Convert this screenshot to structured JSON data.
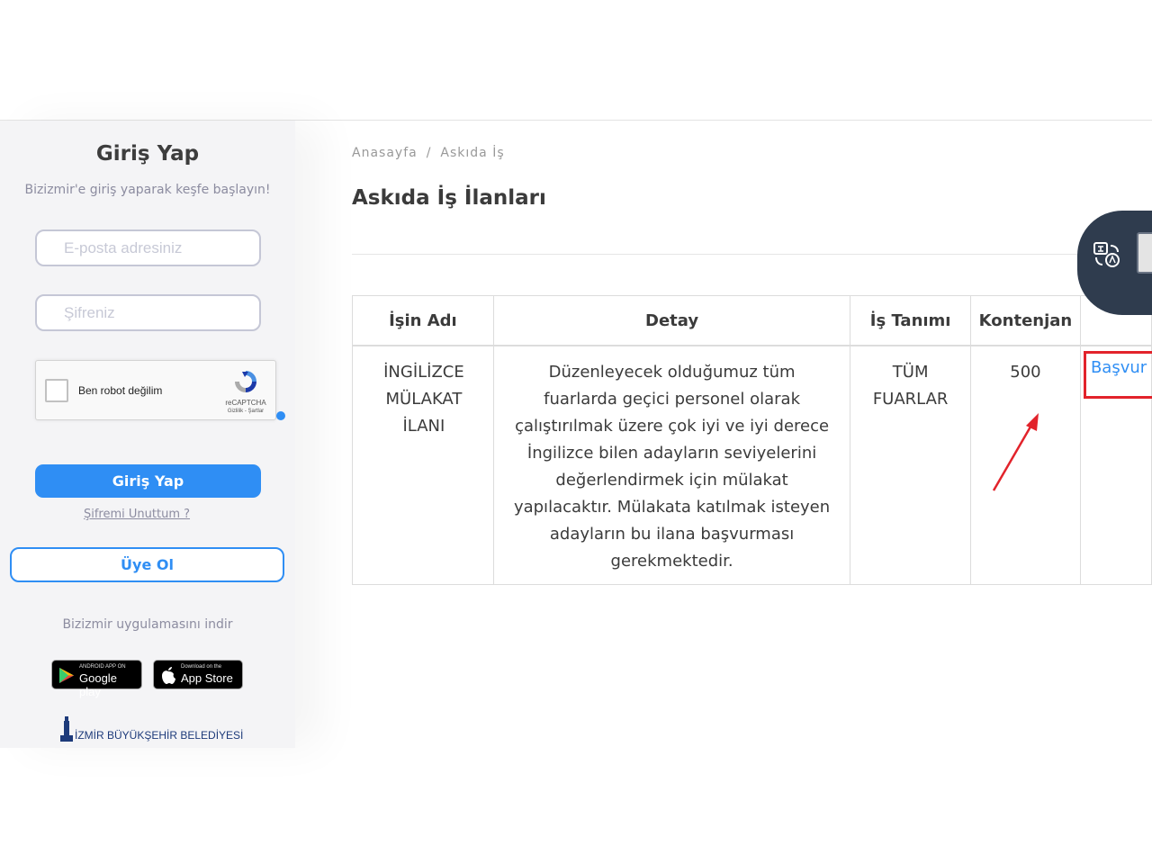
{
  "sidebar": {
    "title": "Giriş Yap",
    "subtitle": "Bizizmir'e giriş yaparak keşfe başlayın!",
    "email_placeholder": "E-posta adresiniz",
    "password_placeholder": "Şifreniz",
    "recaptcha": {
      "label": "Ben robot değilim",
      "brand": "reCAPTCHA",
      "terms": "Gizlilik - Şartlar"
    },
    "login_button": "Giriş Yap",
    "forgot_password": "Şifremi Unuttum ?",
    "register_button": "Üye Ol",
    "app_download_text": "Bizizmir uygulamasını indir",
    "google_play": {
      "small": "ANDROID APP ON",
      "big": "Google play"
    },
    "app_store": {
      "small": "Download on the",
      "big": "App Store"
    },
    "municipality_logo": "İZMİR BÜYÜKŞEHİR BELEDİYESİ"
  },
  "breadcrumb": {
    "home": "Anasayfa",
    "separator": "/",
    "current": "Askıda İş"
  },
  "page_title": "Askıda İş İlanları",
  "table": {
    "headers": [
      "İşin Adı",
      "Detay",
      "İş Tanımı",
      "Kontenjan",
      ""
    ],
    "rows": [
      {
        "job_name": "İNGİLİZCE MÜLAKAT İLANI",
        "detail": "Düzenleyecek olduğumuz tüm fuarlarda geçici personel olarak çalıştırılmak üzere çok iyi ve iyi derece İngilizce bilen adayların seviyelerini değerlendirmek için mülakat yapılacaktır. Mülakata katılmak isteyen adayların bu ilana başvurması gerekmektedir.",
        "job_definition": "TÜM FUARLAR",
        "quota": "500",
        "apply_label": "Başvur"
      }
    ]
  },
  "colors": {
    "accent": "#2f8ef4",
    "highlight": "#e2232b",
    "widget_bg": "#2f3c4e"
  },
  "widget": {
    "icon": "translate-icon"
  }
}
